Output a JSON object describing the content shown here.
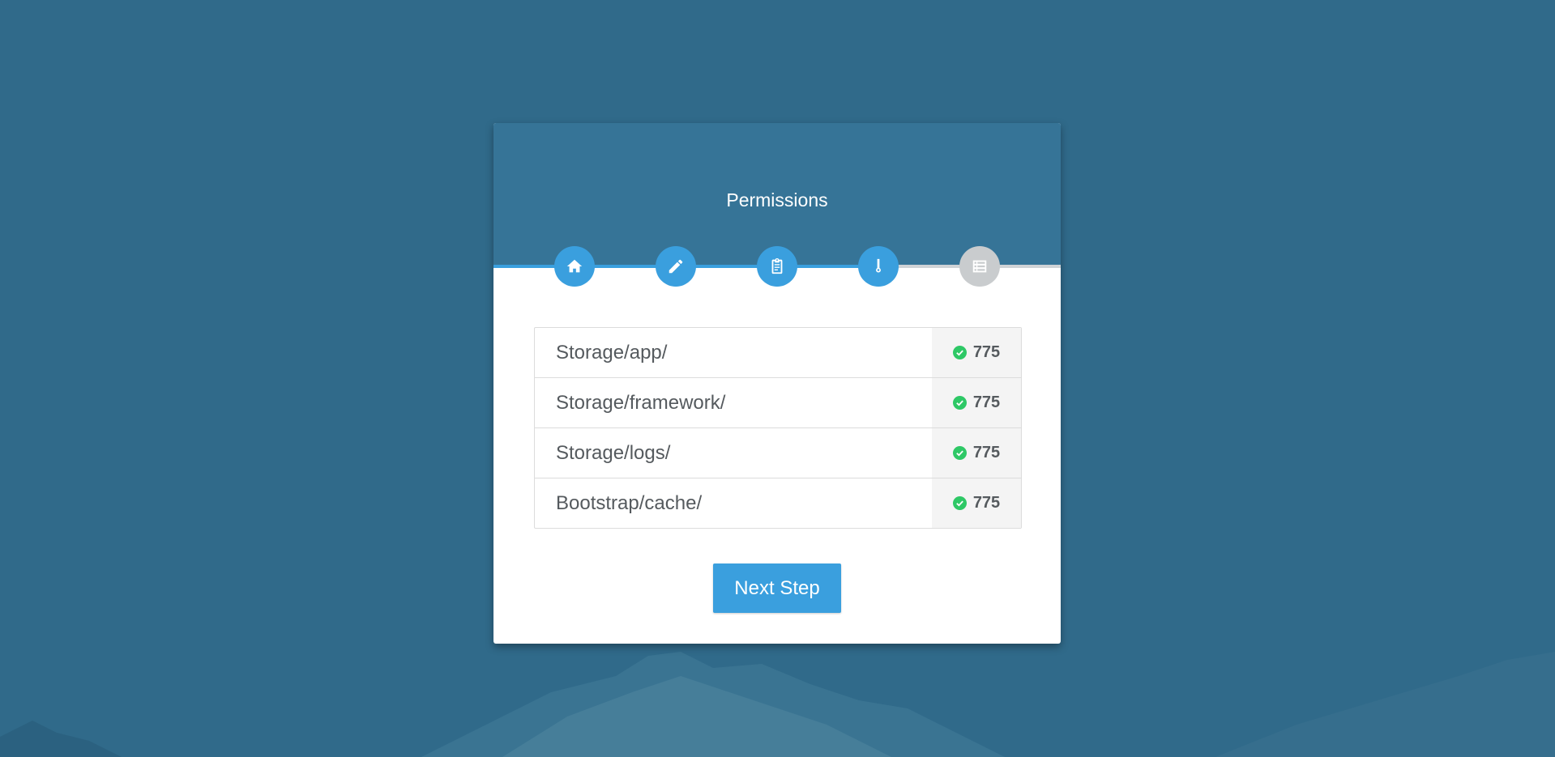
{
  "page": {
    "title": "Permissions"
  },
  "steps": [
    {
      "name": "home",
      "icon": "home-icon",
      "state": "complete"
    },
    {
      "name": "environment",
      "icon": "pencil-icon",
      "state": "complete"
    },
    {
      "name": "requirements",
      "icon": "clipboard-icon",
      "state": "complete"
    },
    {
      "name": "permissions",
      "icon": "key-icon",
      "state": "current"
    },
    {
      "name": "final",
      "icon": "list-icon",
      "state": "pending"
    }
  ],
  "permissions": [
    {
      "path": "Storage/app/",
      "value": "775",
      "status_icon": "check-circle-icon"
    },
    {
      "path": "Storage/framework/",
      "value": "775",
      "status_icon": "check-circle-icon"
    },
    {
      "path": "Storage/logs/",
      "value": "775",
      "status_icon": "check-circle-icon"
    },
    {
      "path": "Bootstrap/cache/",
      "value": "775",
      "status_icon": "check-circle-icon"
    }
  ],
  "actions": {
    "next_label": "Next Step"
  },
  "colors": {
    "background": "#306a8a",
    "header": "#367497",
    "accent": "#3a9fde",
    "success": "#2ec866",
    "inactive_step": "#c9ccce"
  }
}
